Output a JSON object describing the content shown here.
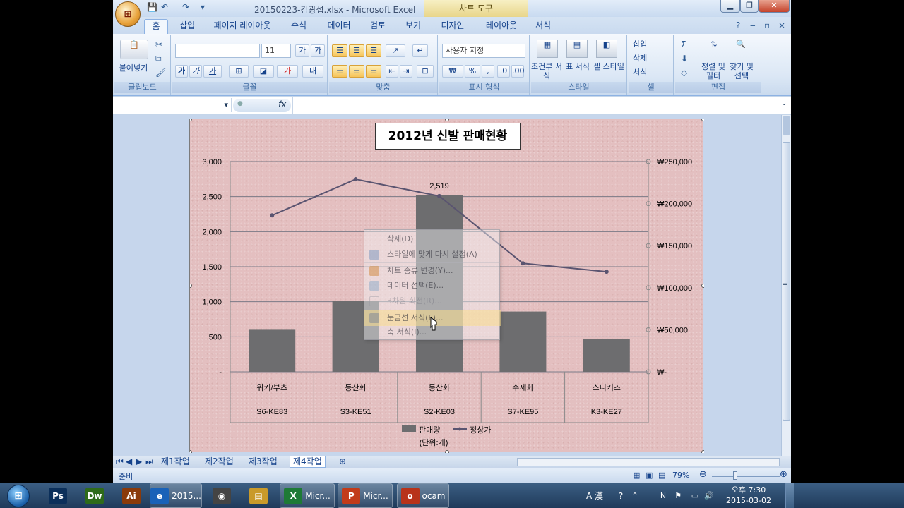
{
  "window": {
    "title": "20150223-김광섭.xlsx - Microsoft Excel",
    "context_tab": "차트 도구",
    "min": "▁",
    "max": "❐",
    "close": "✕"
  },
  "tabs": [
    "홈",
    "삽입",
    "페이지 레이아웃",
    "수식",
    "데이터",
    "검토",
    "보기",
    "디자인",
    "레이아웃",
    "서식"
  ],
  "ribbon": {
    "clipboard": {
      "label": "클립보드",
      "paste": "붙여넣기"
    },
    "font": {
      "label": "글꼴",
      "name": "",
      "size": "11",
      "bold": "가",
      "italic": "가",
      "underline": "가"
    },
    "align": {
      "label": "맞춤"
    },
    "number": {
      "label": "표시 형식",
      "format": "사용자 지정",
      "currency": "₩",
      "percent": "%",
      "comma": ","
    },
    "styles": {
      "label": "스타일",
      "cond": "조건부 서식",
      "table": "표 서식",
      "cell": "셀 스타일"
    },
    "cells": {
      "label": "셀",
      "insert": "삽입",
      "delete": "삭제",
      "format": "서식"
    },
    "edit": {
      "label": "편집",
      "sort": "정렬 및 필터",
      "find": "찾기 및 선택"
    }
  },
  "formula_bar": {
    "fx": "fx",
    "content": ""
  },
  "chart_data": {
    "type": "bar+line",
    "title": "2012년 신발 판매현황",
    "categories": [
      "워커/부츠",
      "등산화",
      "등산화",
      "수제화",
      "스니커즈"
    ],
    "subcategories": [
      "S6-KE83",
      "S3-KE51",
      "S2-KE03",
      "S7-KE95",
      "K3-KE27"
    ],
    "series": [
      {
        "name": "판매량",
        "kind": "bar",
        "axis": "left",
        "values": [
          600,
          1010,
          2519,
          860,
          470
        ],
        "color": "#6d6d6f"
      },
      {
        "name": "정상가",
        "kind": "line",
        "axis": "right",
        "values": [
          186000,
          229000,
          209000,
          129000,
          119000
        ],
        "color": "#5a5470"
      }
    ],
    "data_labels": [
      {
        "series": 0,
        "index": 2,
        "text": "2,519"
      }
    ],
    "left_axis": {
      "min": 0,
      "max": 3000,
      "ticks": [
        "-",
        "500",
        "1,000",
        "1,500",
        "2,000",
        "2,500",
        "3,000"
      ]
    },
    "right_axis": {
      "min": 0,
      "max": 250000,
      "ticks": [
        "₩-",
        "₩50,000",
        "₩100,000",
        "₩150,000",
        "₩200,000",
        "₩250,000"
      ]
    },
    "legend_note": "(단위:개)",
    "grid": true
  },
  "context_menu": {
    "items": [
      {
        "label": "삭제(D)",
        "icon": "none-icon",
        "state": "normal"
      },
      {
        "label": "스타일에 맞게 다시 설정(A)",
        "icon": "reset-style-icon",
        "state": "normal"
      },
      {
        "label": "차트 종류 변경(Y)...",
        "icon": "chart-type-icon",
        "state": "normal"
      },
      {
        "label": "데이터 선택(E)...",
        "icon": "select-data-icon",
        "state": "normal"
      },
      {
        "label": "3차원 회전(R)...",
        "icon": "rotate-3d-icon",
        "state": "disabled"
      },
      {
        "label": "눈금선 서식(F)...",
        "icon": "gridline-format-icon",
        "state": "highlighted"
      },
      {
        "label": "축 서식(I)...",
        "icon": "none-icon",
        "state": "normal"
      }
    ]
  },
  "sheets": [
    "제1작업",
    "제2작업",
    "제3작업",
    "제4작업"
  ],
  "active_sheet": "제4작업",
  "status": {
    "ready": "준비",
    "zoom": "79%"
  },
  "taskbar": {
    "items": [
      {
        "label": "",
        "icon": "photoshop-icon",
        "text": "Ps",
        "color": "#0b2f5a"
      },
      {
        "label": "",
        "icon": "dreamweaver-icon",
        "text": "Dw",
        "color": "#2e6b1a"
      },
      {
        "label": "",
        "icon": "illustrator-icon",
        "text": "Ai",
        "color": "#8a3a0a"
      },
      {
        "label": "2015...",
        "icon": "ie-icon",
        "text": "e",
        "color": "#1a62b8"
      },
      {
        "label": "",
        "icon": "app-icon",
        "text": "◉",
        "color": "#444"
      },
      {
        "label": "",
        "icon": "folder-icon",
        "text": "▤",
        "color": "#c99a2a"
      },
      {
        "label": "Micr...",
        "icon": "excel-icon",
        "text": "X",
        "color": "#1e7a36"
      },
      {
        "label": "Micr...",
        "icon": "powerpoint-icon",
        "text": "P",
        "color": "#c23b1a"
      },
      {
        "label": "ocam",
        "icon": "ocam-icon",
        "text": "o",
        "color": "#b8331a"
      }
    ],
    "tray": {
      "lang": "A 漢",
      "time": "오후 7:30",
      "date": "2015-03-02"
    }
  }
}
